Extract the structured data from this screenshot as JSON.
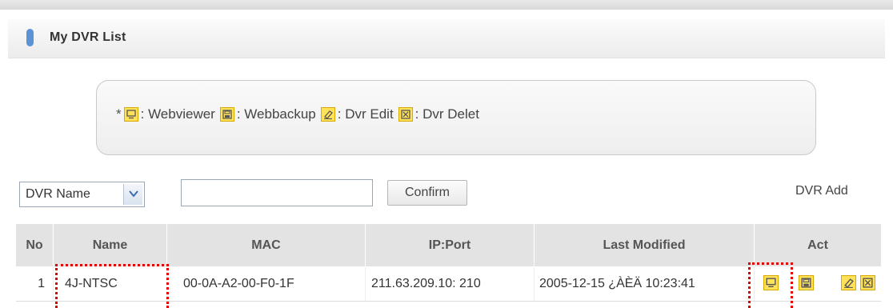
{
  "section": {
    "title": "My DVR List"
  },
  "legend": {
    "star": "*",
    "items": [
      {
        "icon": "webviewer-icon",
        "label": ": Webviewer"
      },
      {
        "icon": "webbackup-icon",
        "label": ": Webbackup"
      },
      {
        "icon": "dvr-edit-icon",
        "label": ": Dvr Edit"
      },
      {
        "icon": "dvr-delete-icon",
        "label": ": Dvr Delet"
      }
    ]
  },
  "search": {
    "field_selected": "DVR Name",
    "input_value": "",
    "confirm_label": "Confirm",
    "add_label": "DVR Add"
  },
  "table": {
    "headers": [
      "No",
      "Name",
      "MAC",
      "IP:Port",
      "Last Modified",
      "Act"
    ],
    "rows": [
      {
        "no": "1",
        "name": "4J-NTSC",
        "mac": "00-0A-A2-00-F0-1F",
        "ip_port": "211.63.209.10: 210",
        "last_modified": "2005-12-15 ¿ÀÈÄ 10:23:41",
        "actions": [
          "webviewer-icon",
          "webbackup-icon",
          "dvr-edit-icon",
          "dvr-delete-icon"
        ]
      }
    ]
  },
  "colors": {
    "icon_fill": "#ffe25a",
    "icon_border": "#d9a800",
    "header_bg": "#e3e3e3",
    "highlight": "#e00000",
    "bullet": "#5b93d6"
  }
}
